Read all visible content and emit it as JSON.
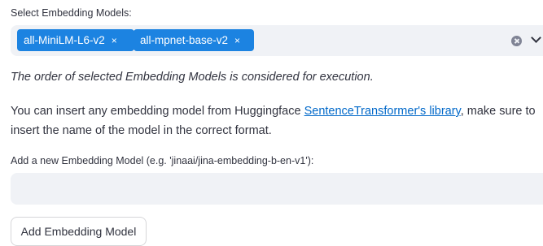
{
  "embedding_select": {
    "label": "Select Embedding Models:",
    "selected": [
      {
        "label": "all-MiniLM-L6-v2",
        "remove_glyph": "×"
      },
      {
        "label": "all-mpnet-base-v2",
        "remove_glyph": "×"
      }
    ],
    "clear_icon": "clear-circle-icon",
    "dropdown_icon": "chevron-down-icon",
    "chip_color": "#1c83e1"
  },
  "order_note": "The order of selected Embedding Models is considered for execution.",
  "info": {
    "text_before": "You can insert any embedding model from Huggingface ",
    "link_text": "SentenceTransformer's library",
    "text_after": ", make sure to insert the name of the model in the correct format."
  },
  "new_model": {
    "label": "Add a new Embedding Model (e.g. 'jinaai/jina-embedding-b-en-v1'):",
    "value": ""
  },
  "add_button": {
    "label": "Add Embedding Model"
  },
  "colors": {
    "link": "#0068c9",
    "input_background": "#f0f2f6",
    "text": "#31333f"
  }
}
